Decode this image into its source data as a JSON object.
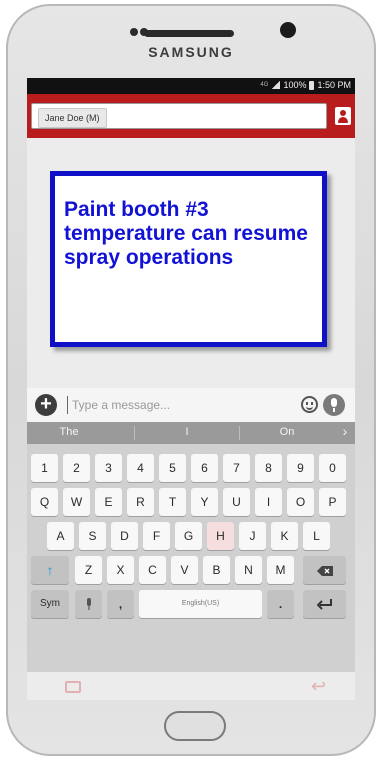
{
  "device": {
    "brand": "SAMSUNG"
  },
  "status_bar": {
    "network": "4G",
    "battery": "100%",
    "time": "1:50 PM"
  },
  "header": {
    "recipient_chip": "Jane Doe (M)",
    "contact_icon": "person-icon",
    "accent_color": "#b91c1c"
  },
  "conversation": {
    "message": "Paint booth #3 temperature can resume spray operations",
    "border_color": "#1010c8",
    "text_color": "#1212d6"
  },
  "composer": {
    "add_icon": "plus-icon",
    "placeholder": "Type a message...",
    "emoji_icon": "emoji-icon",
    "mic_icon": "mic-icon"
  },
  "keyboard": {
    "suggestions": [
      "The",
      "I",
      "On"
    ],
    "suggestion_chevron": "›",
    "row_numbers": [
      "1",
      "2",
      "3",
      "4",
      "5",
      "6",
      "7",
      "8",
      "9",
      "0"
    ],
    "row_top": [
      "Q",
      "W",
      "E",
      "R",
      "T",
      "Y",
      "U",
      "I",
      "O",
      "P"
    ],
    "row_mid": [
      "A",
      "S",
      "D",
      "F",
      "G",
      "H",
      "J",
      "K",
      "L"
    ],
    "row_bottom": [
      "Z",
      "X",
      "C",
      "V",
      "B",
      "N",
      "M"
    ],
    "shift_icon": "shift-icon",
    "backspace_icon": "backspace-icon",
    "sym_label": "Sym",
    "comma": ",",
    "space_label": "English(US)",
    "period": ".",
    "enter_icon": "enter-icon"
  }
}
